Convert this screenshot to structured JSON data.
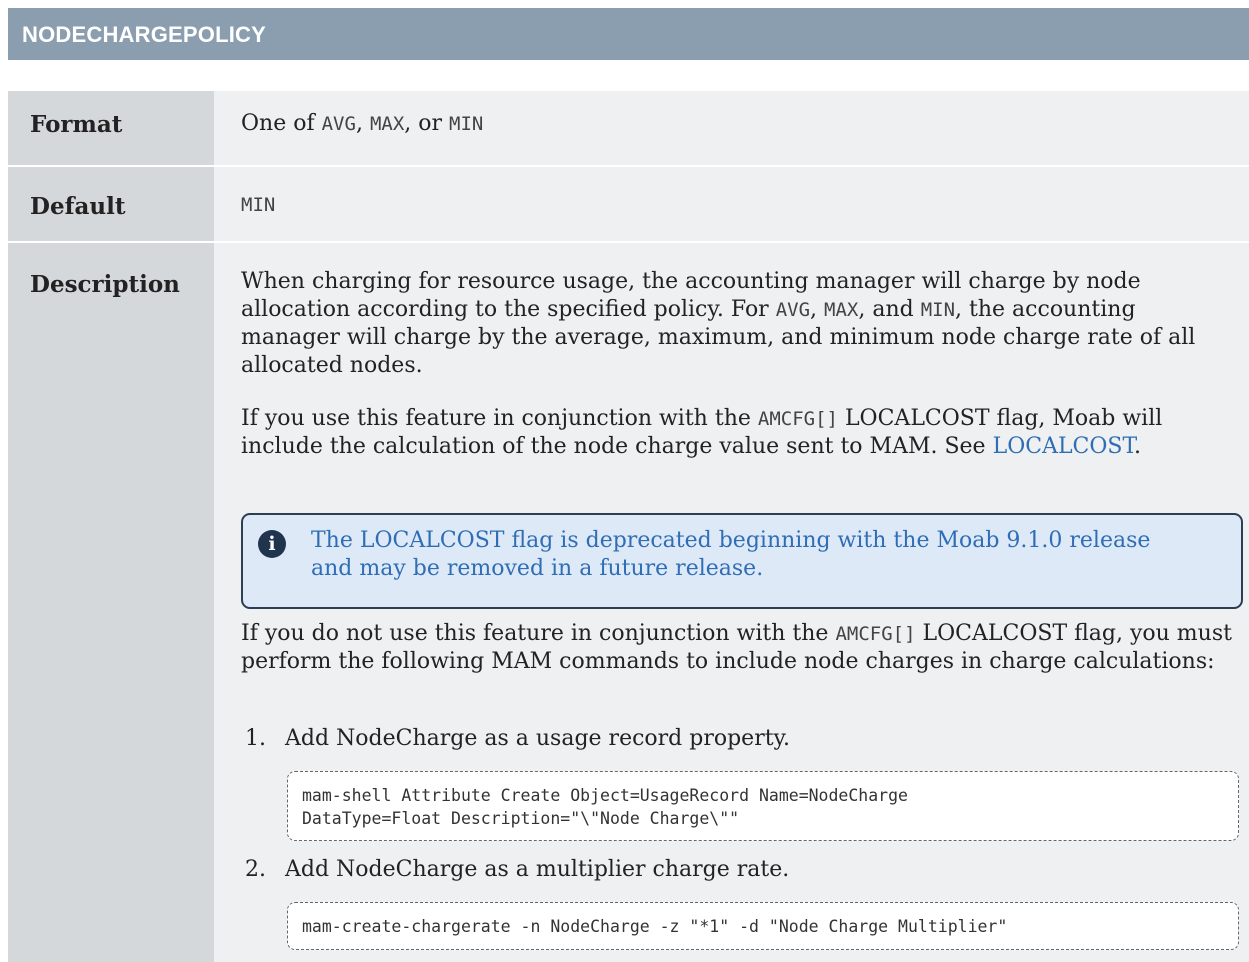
{
  "header": {
    "title": "NODECHARGEPOLICY"
  },
  "format": {
    "label": "Format",
    "prefix": "One of ",
    "opt1": "AVG",
    "sep1": ", ",
    "opt2": "MAX",
    "sep2": ", or ",
    "opt3": "MIN"
  },
  "default": {
    "label": "Default",
    "value": "MIN"
  },
  "description": {
    "label": "Description",
    "p1": {
      "a": "When charging for resource usage, the accounting manager will charge by node allocation according to the specified policy. For ",
      "c1": "AVG",
      "b": ", ",
      "c2": "MAX",
      "c": ", and ",
      "c3": "MIN",
      "d": ", the accounting manager will charge by the average, maximum, and minimum node charge rate of all allocated nodes."
    },
    "p2": {
      "a": "If you use this feature in conjunction with the ",
      "code": "AMCFG[]",
      "b": " LOCALCOST flag, Moab will include the calculation of the node charge value sent to MAM. See ",
      "link": "LOCALCOST",
      "c": "."
    },
    "note": {
      "icon": "info-icon",
      "text": "The LOCALCOST flag is deprecated beginning with the Moab 9.1.0 release and may be removed in a future release."
    },
    "p3": {
      "a": "If you do not use this feature in conjunction with the ",
      "code": "AMCFG[]",
      "b": " LOCALCOST flag, you must perform the following MAM commands to include node charges in charge calculations:"
    },
    "steps": [
      {
        "num": "1.",
        "text": "Add NodeCharge as a usage record property.",
        "code": "mam-shell Attribute Create Object=UsageRecord Name=NodeCharge\nDataType=Float Description=\"\\\"Node Charge\\\"\""
      },
      {
        "num": "2.",
        "text": "Add NodeCharge as a multiplier charge rate.",
        "code": "mam-create-chargerate -n NodeCharge -z \"*1\" -d \"Node Charge Multiplier\""
      }
    ]
  }
}
